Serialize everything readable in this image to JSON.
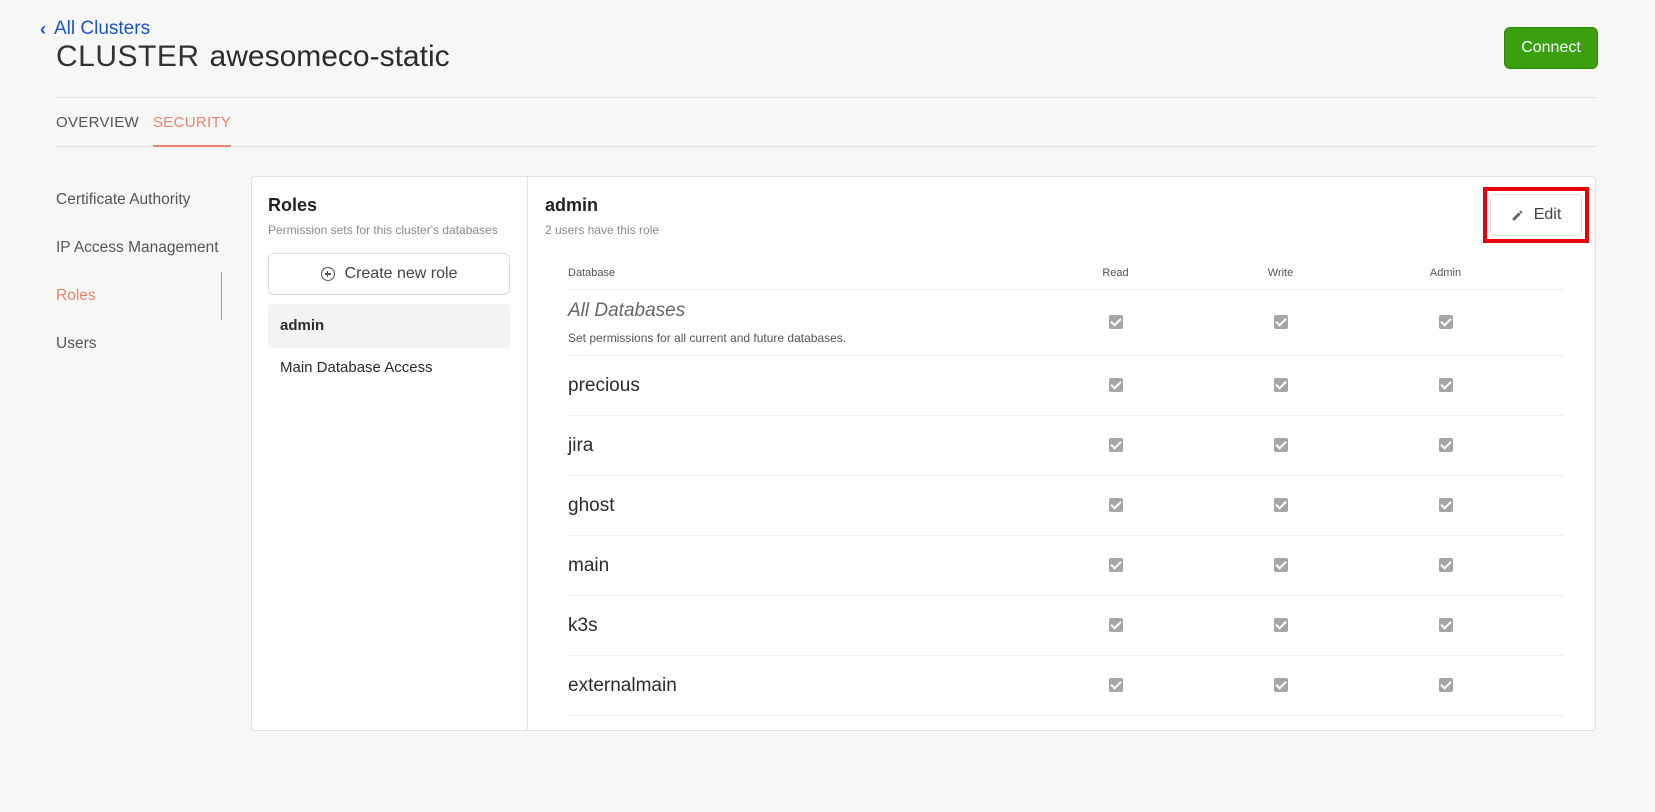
{
  "header": {
    "back_label": "All Clusters",
    "title_prefix": "CLUSTER",
    "cluster_name": "awesomeco-static",
    "connect_label": "Connect"
  },
  "tabs": [
    {
      "label": "OVERVIEW",
      "active": false
    },
    {
      "label": "SECURITY",
      "active": true
    }
  ],
  "sidebar": {
    "items": [
      {
        "label": "Certificate Authority",
        "active": false
      },
      {
        "label": "IP Access Management",
        "active": false
      },
      {
        "label": "Roles",
        "active": true
      },
      {
        "label": "Users",
        "active": false
      }
    ]
  },
  "roles": {
    "title": "Roles",
    "subtitle": "Permission sets for this cluster's databases",
    "create_label": "Create new role",
    "items": [
      {
        "label": "admin",
        "selected": true
      },
      {
        "label": "Main Database Access",
        "selected": false
      }
    ]
  },
  "detail": {
    "title": "admin",
    "subtitle": "2 users have this role",
    "edit_label": "Edit",
    "columns": {
      "database": "Database",
      "read": "Read",
      "write": "Write",
      "admin": "Admin"
    },
    "all_databases": {
      "name": "All Databases",
      "description": "Set permissions for all current and future databases.",
      "read": true,
      "write": true,
      "admin": true
    },
    "rows": [
      {
        "name": "precious",
        "read": true,
        "write": true,
        "admin": true
      },
      {
        "name": "jira",
        "read": true,
        "write": true,
        "admin": true
      },
      {
        "name": "ghost",
        "read": true,
        "write": true,
        "admin": true
      },
      {
        "name": "main",
        "read": true,
        "write": true,
        "admin": true
      },
      {
        "name": "k3s",
        "read": true,
        "write": true,
        "admin": true
      },
      {
        "name": "externalmain",
        "read": true,
        "write": true,
        "admin": true
      }
    ]
  },
  "colors": {
    "accent": "#e8846b",
    "link": "#1a57c6",
    "connect_bg": "#3aa010",
    "highlight": "#e8000b",
    "checkbox": "#a6a6a6"
  }
}
